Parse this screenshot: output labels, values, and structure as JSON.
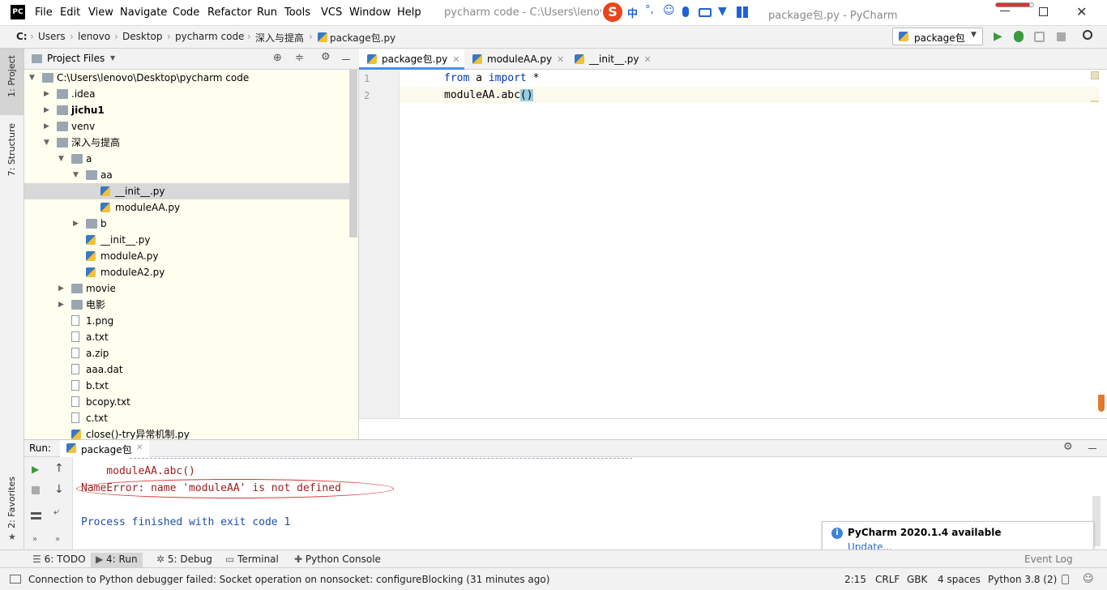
{
  "titlebar": {
    "app_icon": "PC",
    "menus": [
      "File",
      "Edit",
      "View",
      "Navigate",
      "Code",
      "Refactor",
      "Run",
      "Tools",
      "VCS",
      "Window",
      "Help"
    ],
    "title_left": "pycharm code - C:\\Users\\lenovo\\",
    "title_right": "package包.py - PyCharm"
  },
  "breadcrumb": {
    "items": [
      "C:",
      "Users",
      "lenovo",
      "Desktop",
      "pycharm code",
      "深入与提高",
      "package包.py"
    ],
    "run_config": "package包"
  },
  "left_tools": {
    "project": "1: Project",
    "structure": "7: Structure",
    "favorites": "2: Favorites"
  },
  "project": {
    "header": "Project Files",
    "tree": [
      {
        "label": "C:\\Users\\lenovo\\Desktop\\pycharm code",
        "type": "folder",
        "indent": 0,
        "arrow": "▼"
      },
      {
        "label": ".idea",
        "type": "folder",
        "indent": 1,
        "arrow": "▶"
      },
      {
        "label": "jichu1",
        "type": "folder",
        "indent": 1,
        "arrow": "▶"
      },
      {
        "label": "venv",
        "type": "folder",
        "indent": 1,
        "arrow": "▶"
      },
      {
        "label": "深入与提高",
        "type": "folder",
        "indent": 1,
        "arrow": "▼"
      },
      {
        "label": "a",
        "type": "folder",
        "indent": 2,
        "arrow": "▼"
      },
      {
        "label": "aa",
        "type": "folder",
        "indent": 3,
        "arrow": "▼"
      },
      {
        "label": "__init__.py",
        "type": "py",
        "indent": 4,
        "arrow": ""
      },
      {
        "label": "moduleAA.py",
        "type": "py",
        "indent": 4,
        "arrow": ""
      },
      {
        "label": "b",
        "type": "folder",
        "indent": 3,
        "arrow": "▶"
      },
      {
        "label": "__init__.py",
        "type": "py",
        "indent": 3,
        "arrow": ""
      },
      {
        "label": "moduleA.py",
        "type": "py",
        "indent": 3,
        "arrow": ""
      },
      {
        "label": "moduleA2.py",
        "type": "py",
        "indent": 3,
        "arrow": ""
      },
      {
        "label": "movie",
        "type": "folder",
        "indent": 2,
        "arrow": "▶"
      },
      {
        "label": "电影",
        "type": "folder",
        "indent": 2,
        "arrow": "▶"
      },
      {
        "label": "1.png",
        "type": "file",
        "indent": 2,
        "arrow": ""
      },
      {
        "label": "a.txt",
        "type": "file",
        "indent": 2,
        "arrow": ""
      },
      {
        "label": "a.zip",
        "type": "file",
        "indent": 2,
        "arrow": ""
      },
      {
        "label": "aaa.dat",
        "type": "file",
        "indent": 2,
        "arrow": ""
      },
      {
        "label": "b.txt",
        "type": "file",
        "indent": 2,
        "arrow": ""
      },
      {
        "label": "bcopy.txt",
        "type": "file",
        "indent": 2,
        "arrow": ""
      },
      {
        "label": "c.txt",
        "type": "file",
        "indent": 2,
        "arrow": ""
      },
      {
        "label": "close()-try异常机制.py",
        "type": "py",
        "indent": 2,
        "arrow": ""
      }
    ]
  },
  "editor": {
    "tabs": [
      "package包.py",
      "moduleAA.py",
      "__init__.py"
    ],
    "lines": [
      {
        "num": "1",
        "kw1": "from",
        "mid": " a ",
        "kw2": "import",
        "rest": " *"
      },
      {
        "num": "2",
        "text": "moduleAA.abc",
        "paren": "()"
      }
    ]
  },
  "run": {
    "label": "Run:",
    "tab": "package包",
    "lines": [
      "    moduleAA.abc()",
      "NameError: name 'moduleAA' is not defined",
      "",
      "Process finished with exit code 1"
    ]
  },
  "bottom_tabs": [
    "6: TODO",
    "4: Run",
    "5: Debug",
    "Terminal",
    "Python Console",
    "Event Log"
  ],
  "notification": {
    "title": "PyCharm 2020.1.4 available",
    "link": "Update..."
  },
  "status": {
    "message": "Connection to Python debugger failed: Socket operation on nonsocket: configureBlocking (31 minutes ago)",
    "position": "2:15",
    "line_sep": "CRLF",
    "encoding": "GBK",
    "indent": "4 spaces",
    "interpreter": "Python 3.8 (2)"
  }
}
